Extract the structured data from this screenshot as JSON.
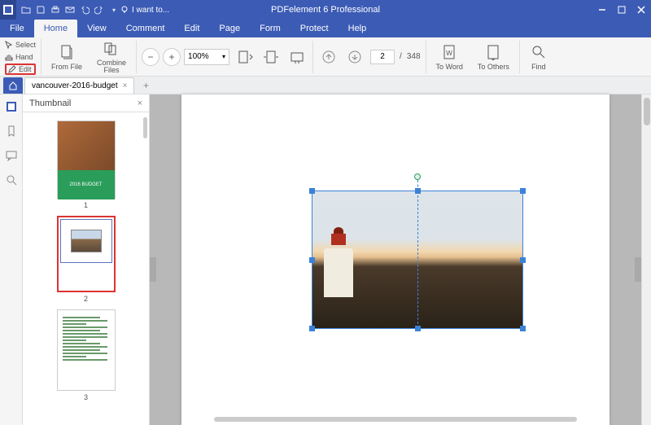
{
  "app": {
    "title": "PDFelement 6 Professional"
  },
  "titlebar": {
    "i_want": "I want to..."
  },
  "menu": {
    "file": "File",
    "home": "Home",
    "view": "View",
    "comment": "Comment",
    "edit": "Edit",
    "page": "Page",
    "form": "Form",
    "protect": "Protect",
    "help": "Help"
  },
  "ribbon": {
    "select": "Select",
    "hand": "Hand",
    "edit": "Edit",
    "from_file": "From File",
    "combine_files": "Combine\nFiles",
    "zoom_value": "100%",
    "page_current": "2",
    "page_sep": "/",
    "page_total": "348",
    "to_word": "To Word",
    "to_others": "To Others",
    "find": "Find"
  },
  "tabs": {
    "doc_name": "vancouver-2016-budget"
  },
  "thumb": {
    "title": "Thumbnail",
    "t1_banner": "2016 BUDGET",
    "n1": "1",
    "n2": "2",
    "n3": "3"
  }
}
